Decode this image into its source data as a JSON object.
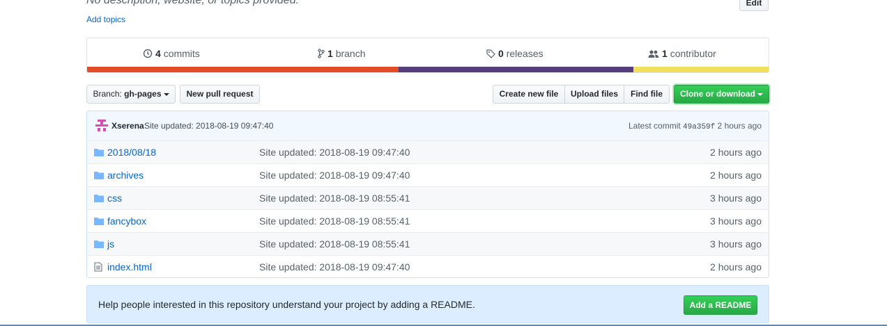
{
  "repo": {
    "description": "No description, website, or topics provided.",
    "add_topics": "Add topics",
    "edit_label": "Edit"
  },
  "summary": {
    "commits": {
      "count": "4",
      "label": "commits"
    },
    "branches": {
      "count": "1",
      "label": "branch"
    },
    "releases": {
      "count": "0",
      "label": "releases"
    },
    "contributors": {
      "count": "1",
      "label": "contributor"
    }
  },
  "language_bar": [
    {
      "color": "#e34c26",
      "percent": 45.7
    },
    {
      "color": "#563d7c",
      "percent": 34.5
    },
    {
      "color": "#f1e05a",
      "percent": 19.8
    }
  ],
  "toolbar": {
    "branch_prefix": "Branch:",
    "branch_name": "gh-pages",
    "new_pull_request": "New pull request",
    "create_new_file": "Create new file",
    "upload_files": "Upload files",
    "find_file": "Find file",
    "clone_or_download": "Clone or download"
  },
  "commit_tease": {
    "author": "Xserena",
    "message": "Site updated: 2018-08-19 09:47:40",
    "latest_label": "Latest commit",
    "sha": "49a359f",
    "age": "2 hours ago"
  },
  "files": [
    {
      "type": "folder",
      "name": "2018/08/18",
      "message": "Site updated: 2018-08-19 09:47:40",
      "age": "2 hours ago"
    },
    {
      "type": "folder",
      "name": "archives",
      "message": "Site updated: 2018-08-19 09:47:40",
      "age": "2 hours ago"
    },
    {
      "type": "folder",
      "name": "css",
      "message": "Site updated: 2018-08-19 08:55:41",
      "age": "3 hours ago"
    },
    {
      "type": "folder",
      "name": "fancybox",
      "message": "Site updated: 2018-08-19 08:55:41",
      "age": "3 hours ago"
    },
    {
      "type": "folder",
      "name": "js",
      "message": "Site updated: 2018-08-19 08:55:41",
      "age": "3 hours ago"
    },
    {
      "type": "file",
      "name": "index.html",
      "message": "Site updated: 2018-08-19 09:47:40",
      "age": "2 hours ago"
    }
  ],
  "readme_prompt": {
    "text": "Help people interested in this repository understand your project by adding a README.",
    "button": "Add a README"
  }
}
